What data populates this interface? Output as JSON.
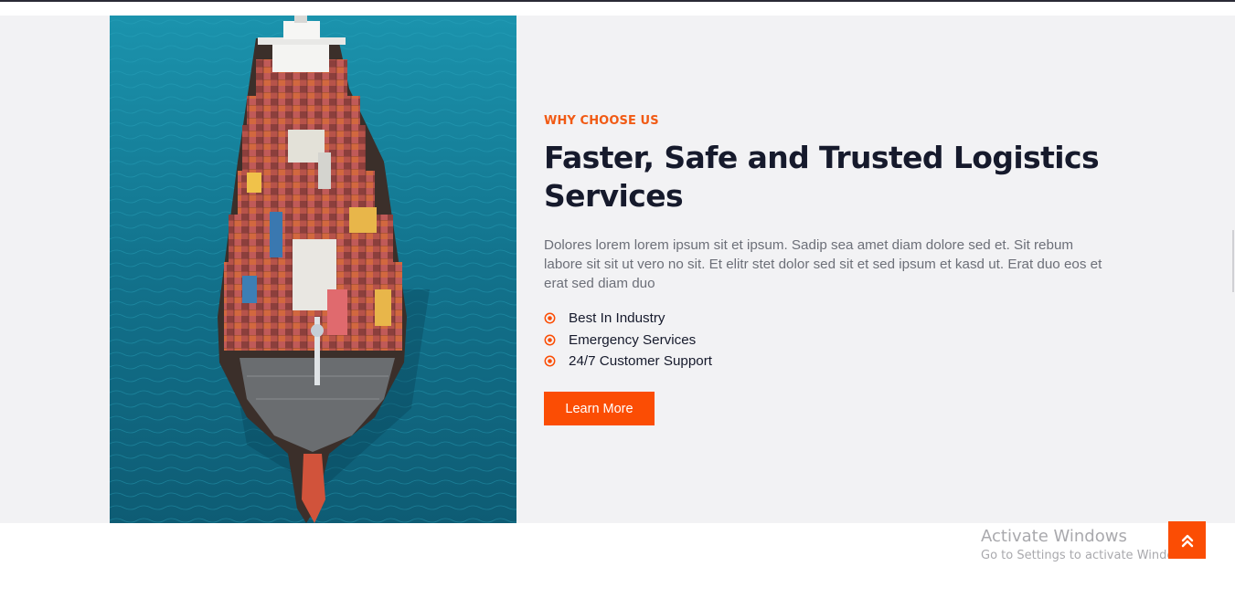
{
  "about": {
    "eyebrow": "WHY CHOOSE US",
    "headline_line1": "Faster, Safe and Trusted Logistics",
    "headline_line2": "Services",
    "description": "Dolores lorem lorem ipsum sit et ipsum. Sadip sea amet diam dolore sed et. Sit rebum labore sit sit ut vero no sit. Et elitr stet dolor sed sit et sed ipsum et kasd ut. Erat duo eos et erat sed diam duo",
    "features": [
      {
        "label": "Best In Industry",
        "icon": "dot-circle-icon"
      },
      {
        "label": "Emergency Services",
        "icon": "dot-circle-icon"
      },
      {
        "label": "24/7 Customer Support",
        "icon": "dot-circle-icon"
      }
    ],
    "cta_label": "Learn More",
    "image_subject": "cargo-ship-aerial-photo"
  },
  "overlay": {
    "watermark_title": "Activate Windows",
    "watermark_subtitle": "Go to Settings to activate Windows.",
    "back_to_top_icon": "double-chevron-up-icon"
  },
  "colors": {
    "accent": "#fb4d04",
    "eyebrow": "#f15a14",
    "heading": "#161a2c",
    "body_text": "#6c6f78",
    "section_bg": "#f2f2f4",
    "sea": "#137a92"
  }
}
